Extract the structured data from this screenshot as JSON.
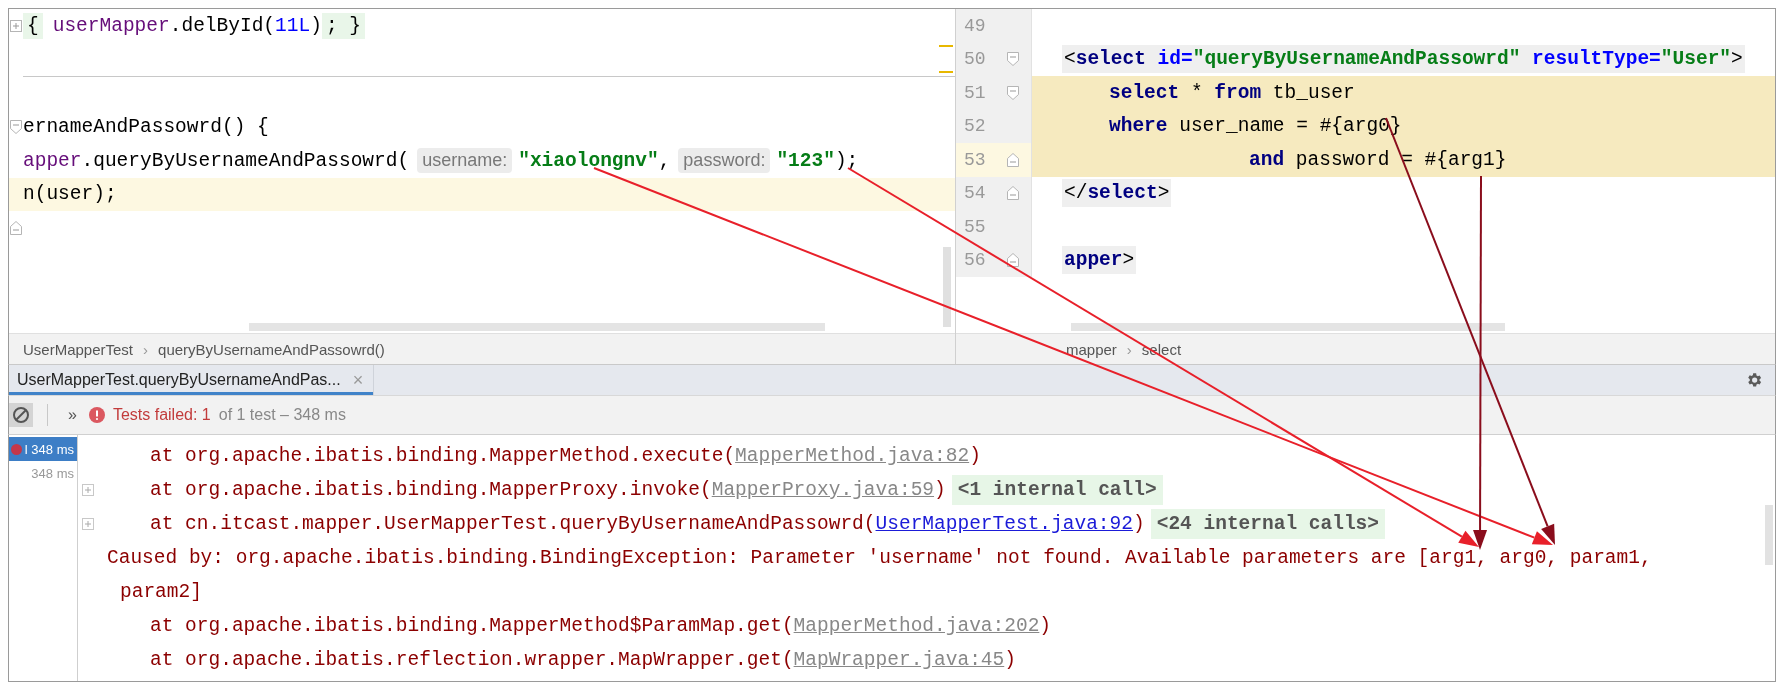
{
  "left_editor": {
    "lines": [
      {
        "kind": "top",
        "current": false,
        "collapsed": true,
        "fold_start": false,
        "fold_end": false,
        "segments": [
          {
            "kind": "fold",
            "tokens": [
              {
                "text": "{",
                "kind": "plain"
              }
            ]
          },
          {
            "kind": "code",
            "tokens": [
              {
                "text": "userMapper",
                "kind": "field"
              },
              {
                "text": ".delById(",
                "kind": "plain"
              },
              {
                "text": "11L",
                "kind": "number"
              },
              {
                "text": ")",
                "kind": "plain"
              }
            ]
          },
          {
            "kind": "fold",
            "tokens": [
              {
                "text": "; }",
                "kind": "plain"
              }
            ]
          }
        ]
      },
      {
        "kind": "blank",
        "current": false,
        "collapsed": false,
        "fold_start": false,
        "fold_end": false
      },
      {
        "kind": "blank",
        "current": false,
        "collapsed": false,
        "fold_start": false,
        "fold_end": false
      },
      {
        "kind": "top",
        "current": false,
        "collapsed": false,
        "fold_start": true,
        "fold_end": false,
        "segments": [
          {
            "kind": "code",
            "tokens": [
              {
                "text": "ernameAndPassowrd() {",
                "kind": "plain"
              }
            ]
          }
        ]
      },
      {
        "kind": "top",
        "current": false,
        "collapsed": false,
        "fold_start": false,
        "fold_end": false,
        "segments": [
          {
            "kind": "code",
            "tokens": [
              {
                "text": "apper",
                "kind": "field"
              },
              {
                "text": ".queryByUsernameAndPassowrd(",
                "kind": "plain"
              }
            ]
          },
          {
            "kind": "hint",
            "text": "username:"
          },
          {
            "kind": "code",
            "tokens": [
              {
                "text": "\"xiaolongnv\"",
                "kind": "string"
              },
              {
                "text": ",",
                "kind": "plain"
              }
            ]
          },
          {
            "kind": "hint",
            "text": "password:"
          },
          {
            "kind": "code",
            "tokens": [
              {
                "text": "\"123\"",
                "kind": "string"
              },
              {
                "text": ");",
                "kind": "plain"
              }
            ]
          }
        ]
      },
      {
        "kind": "top",
        "current": true,
        "collapsed": false,
        "fold_start": false,
        "fold_end": false,
        "segments": [
          {
            "kind": "code",
            "tokens": [
              {
                "text": "n(user);",
                "kind": "plain"
              }
            ]
          }
        ]
      },
      {
        "kind": "blank",
        "current": false,
        "collapsed": false,
        "fold_start": false,
        "fold_end": true
      }
    ],
    "breadcrumbs": [
      {
        "kind": "crumb",
        "text": "UserMapperTest"
      },
      {
        "kind": "separator",
        "text": "›"
      },
      {
        "kind": "crumb",
        "text": "queryByUsernameAndPassowrd()"
      }
    ]
  },
  "right_editor": {
    "lines": [
      {
        "number": "49",
        "kind": "blank",
        "current": false,
        "injected": false,
        "fold_start": false,
        "fold_end": false
      },
      {
        "number": "50",
        "kind": "top",
        "current": false,
        "injected": false,
        "fold_start": true,
        "fold_end": false,
        "segments": [
          {
            "kind": "tag",
            "tokens": [
              {
                "text": "<",
                "kind": "plain"
              },
              {
                "text": "select",
                "kind": "tag"
              },
              {
                "text": " id=",
                "kind": "attr"
              },
              {
                "text": "\"queryByUsernameAndPassowrd\"",
                "kind": "value"
              },
              {
                "text": " resultType=",
                "kind": "attr"
              },
              {
                "text": "\"User\"",
                "kind": "value"
              },
              {
                "text": ">",
                "kind": "plain"
              }
            ]
          }
        ]
      },
      {
        "number": "51",
        "kind": "child",
        "current": false,
        "injected": true,
        "fold_start": true,
        "fold_end": false,
        "segments": [
          {
            "kind": "code",
            "tokens": [
              {
                "text": "select",
                "kind": "keyword"
              },
              {
                "text": " * ",
                "kind": "plain"
              },
              {
                "text": "from",
                "kind": "keyword"
              },
              {
                "text": " tb_user",
                "kind": "plain"
              }
            ]
          }
        ]
      },
      {
        "number": "52",
        "kind": "child",
        "current": false,
        "injected": true,
        "fold_start": false,
        "fold_end": false,
        "segments": [
          {
            "kind": "code",
            "tokens": [
              {
                "text": "where",
                "kind": "keyword"
              },
              {
                "text": " user_name = #{arg0}",
                "kind": "plain"
              }
            ]
          }
        ]
      },
      {
        "number": "53",
        "kind": "continuation",
        "current": true,
        "injected": true,
        "fold_start": false,
        "fold_end": true,
        "segments": [
          {
            "kind": "code",
            "tokens": [
              {
                "text": "and",
                "kind": "keyword"
              },
              {
                "text": " password = #{arg1}",
                "kind": "plain"
              }
            ]
          }
        ]
      },
      {
        "number": "54",
        "kind": "top",
        "current": false,
        "injected": false,
        "fold_start": false,
        "fold_end": true,
        "segments": [
          {
            "kind": "tag",
            "tokens": [
              {
                "text": "</",
                "kind": "plain"
              },
              {
                "text": "select",
                "kind": "tag"
              },
              {
                "text": ">",
                "kind": "plain"
              }
            ]
          }
        ]
      },
      {
        "number": "55",
        "kind": "blank",
        "current": false,
        "injected": false,
        "fold_start": false,
        "fold_end": false
      },
      {
        "number": "56",
        "kind": "outdent",
        "current": false,
        "injected": false,
        "fold_start": false,
        "fold_end": true,
        "segments": [
          {
            "kind": "tag",
            "tokens": [
              {
                "text": "apper",
                "kind": "tag"
              },
              {
                "text": ">",
                "kind": "plain"
              }
            ]
          }
        ]
      }
    ],
    "breadcrumbs": [
      {
        "kind": "crumb",
        "text": "mapper"
      },
      {
        "kind": "separator",
        "text": "›"
      },
      {
        "kind": "crumb",
        "text": "select"
      }
    ]
  },
  "run_panel": {
    "tabs": [
      {
        "label": "UserMapperTest.queryByUsernameAndPas...",
        "close": "×",
        "selected": true
      }
    ],
    "toolbar": {
      "expand": "»",
      "status": "Tests failed: 1",
      "summary": "of 1 test – 348 ms"
    },
    "tests": [
      {
        "label": "l 348 ms",
        "failed": true,
        "selected": true
      },
      {
        "label": "348 ms",
        "failed": false,
        "selected": false
      }
    ],
    "console": [
      {
        "kind": "frame",
        "foldable": false,
        "tokens": [
          {
            "text": "at org.apache.ibatis.binding.MapperMethod.execute(",
            "kind": "text"
          },
          {
            "text": "MapperMethod.java:82",
            "kind": "link"
          },
          {
            "text": ")",
            "kind": "text"
          }
        ]
      },
      {
        "kind": "frame",
        "foldable": true,
        "tokens": [
          {
            "text": "at org.apache.ibatis.binding.MapperProxy.invoke(",
            "kind": "text"
          },
          {
            "text": "MapperProxy.java:59",
            "kind": "link"
          },
          {
            "text": ")",
            "kind": "text"
          },
          {
            "text": "<1 internal call>",
            "kind": "folded"
          }
        ]
      },
      {
        "kind": "frame",
        "foldable": true,
        "tokens": [
          {
            "text": "at cn.itcast.mapper.UserMapperTest.queryByUsernameAndPassowrd(",
            "kind": "text"
          },
          {
            "text": "UserMapperTest.java:92",
            "kind": "source"
          },
          {
            "text": ")",
            "kind": "text"
          },
          {
            "text": "<24 internal calls>",
            "kind": "folded"
          }
        ]
      },
      {
        "kind": "caused",
        "foldable": false,
        "tokens": [
          {
            "text": "Caused by: org.apache.ibatis.binding.BindingException: Parameter 'username' not found. Available parameters are [arg1, arg0, param1,",
            "kind": "text"
          }
        ]
      },
      {
        "kind": "continuation",
        "foldable": false,
        "tokens": [
          {
            "text": "param2]",
            "kind": "text"
          }
        ]
      },
      {
        "kind": "frame",
        "foldable": false,
        "tokens": [
          {
            "text": "at org.apache.ibatis.binding.MapperMethod$ParamMap.get(",
            "kind": "text"
          },
          {
            "text": "MapperMethod.java:202",
            "kind": "link"
          },
          {
            "text": ")",
            "kind": "text"
          }
        ]
      },
      {
        "kind": "frame",
        "foldable": false,
        "tokens": [
          {
            "text": "at org.apache.ibatis.reflection.wrapper.MapWrapper.get(",
            "kind": "text"
          },
          {
            "text": "MapWrapper.java:45",
            "kind": "link"
          },
          {
            "text": ")",
            "kind": "text"
          }
        ]
      }
    ]
  }
}
